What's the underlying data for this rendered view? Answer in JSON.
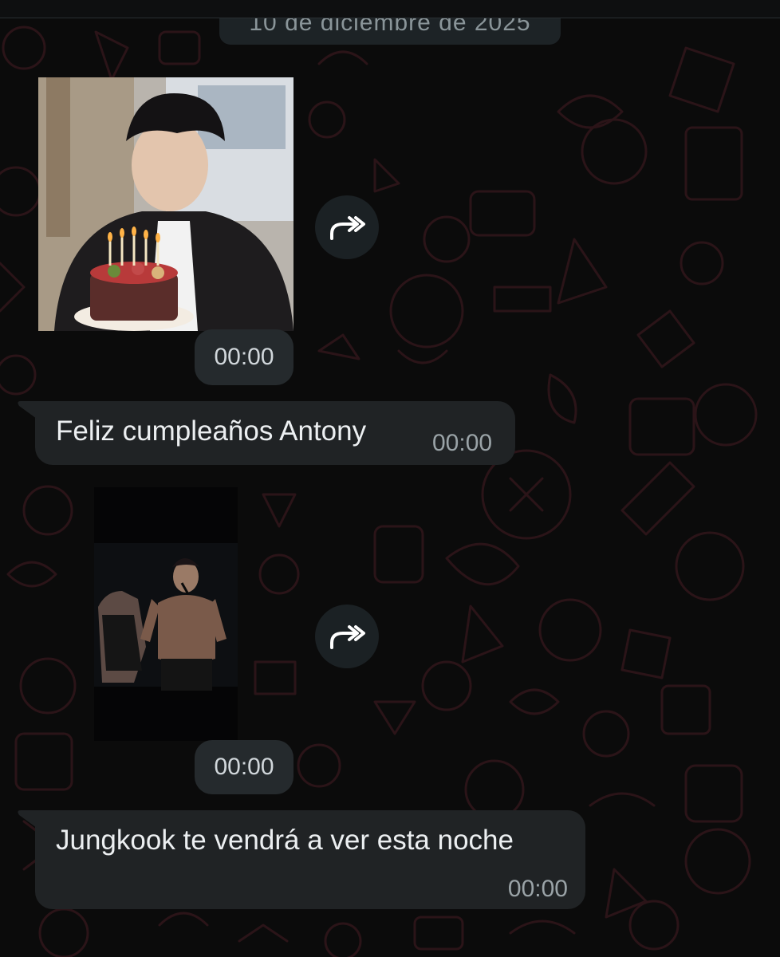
{
  "chat": {
    "date_separator": "10 de diciembre de 2025",
    "messages": [
      {
        "kind": "image",
        "image_subject": "person-blowing-birthday-cake-candles",
        "time": "00:00"
      },
      {
        "kind": "text",
        "text": "Feliz cumpleaños Antony",
        "time": "00:00"
      },
      {
        "kind": "image",
        "image_subject": "dark-stage-performance-photo",
        "time": "00:00"
      },
      {
        "kind": "text",
        "text": "Jungkook te vendrá a ver esta noche",
        "time": "00:00"
      }
    ]
  },
  "icons": {
    "forward": "forward-arrow-icon"
  },
  "colors": {
    "background": "#0b0b0b",
    "wallpaper_doodles": "#2b1418",
    "bubble": "#202325",
    "time_chip": "#252a2d",
    "forward_button": "#1b2124",
    "text_primary": "#eceff1",
    "text_meta": "#9aa3a7"
  }
}
